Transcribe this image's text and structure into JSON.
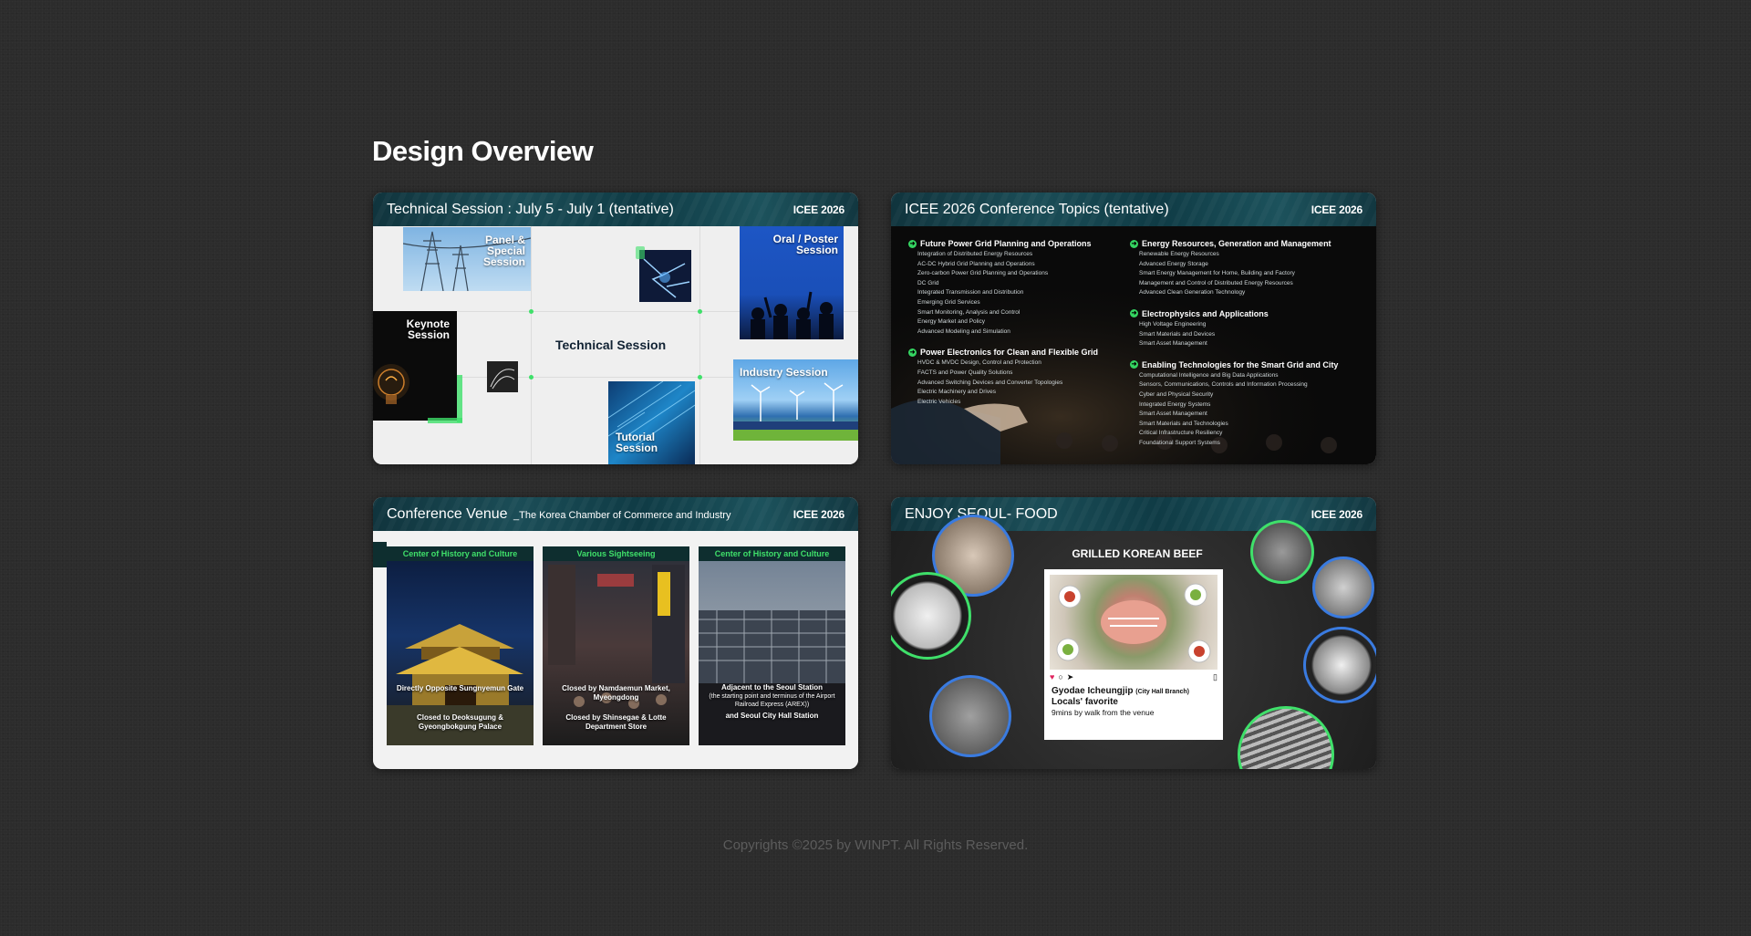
{
  "page_title": "Design Overview",
  "cards": [
    {
      "title": "Technical Session : July 5 - July 1 (tentative)",
      "badge": "ICEE 2026",
      "tiles": {
        "panel": "Panel & Special Session",
        "oral": "Oral / Poster Session",
        "keynote": "Keynote Session",
        "center": "Technical Session",
        "industry": "Industry Session",
        "tutorial": "Tutorial Session"
      }
    },
    {
      "title": "ICEE 2026 Conference Topics (tentative)",
      "badge": "ICEE 2026",
      "topics_left": [
        {
          "head": "Future Power Grid Planning and Operations",
          "items": [
            "Integration of Distributed Energy Resources",
            "AC-DC Hybrid Grid Planning and Operations",
            "Zero-carbon Power Grid Planning and Operations",
            "DC Grid",
            "Integrated Transmission and Distribution",
            "Emerging Grid Services",
            "Smart Monitoring, Analysis and Control",
            "Energy Market and Policy",
            "Advanced Modeling and Simulation"
          ]
        },
        {
          "head": "Power Electronics for Clean and Flexible Grid",
          "items": [
            "HVDC & MVDC Design, Control and Protection",
            "FACTS and Power Quality Solutions",
            "Advanced Switching Devices and Converter Topologies",
            "Electric Machinery and Drives",
            "Electric Vehicles"
          ]
        }
      ],
      "topics_right": [
        {
          "head": "Energy Resources, Generation and Management",
          "items": [
            "Renewable Energy Resources",
            "Advanced Energy Storage",
            "Smart Energy Management for Home, Building and Factory",
            "Management and Control of Distributed Energy Resources",
            "Advanced Clean Generation Technology"
          ]
        },
        {
          "head": "Electrophysics and Applications",
          "items": [
            "High Voltage Engineering",
            "Smart Materials and Devices",
            "Smart Asset Management"
          ]
        },
        {
          "head": "Enabling Technologies for the Smart Grid and City",
          "items": [
            "Computational Intelligence and Big Data Applications",
            "Sensors, Communications, Controls and Information Processing",
            "Cyber and Physical Security",
            "Integrated Energy Systems",
            "Smart Asset Management",
            "Smart Materials and Technologies",
            "Critical Infrastructure Resiliency",
            "Foundational Support Systems"
          ]
        }
      ]
    },
    {
      "title": "Conference Venue",
      "subtitle": "_The Korea Chamber of Commerce and Industry",
      "badge": "ICEE 2026",
      "venues": [
        {
          "tag": "Center of History and Culture",
          "cap1": "Directly Opposite Sungnyemun Gate",
          "cap2": "Closed to Deoksugung & Gyeongbokgung Palace"
        },
        {
          "tag": "Various Sightseeing",
          "cap1": "Closed by Namdaemun Market, Myeongdong",
          "cap2": "Closed by Shinsegae & Lotte Department Store"
        },
        {
          "tag": "Center of History and Culture",
          "cap1": "Adjacent to the Seoul Station",
          "cap1b": "(the starting point and terminus of the Airport Railroad Express (AREX))",
          "cap2": "and Seoul City Hall Station"
        }
      ]
    },
    {
      "title": "ENJOY SEOUL- FOOD",
      "badge": "ICEE 2026",
      "food_title": "GRILLED KOREAN BEEF",
      "post_name": "Gyodae Icheungjip",
      "post_branch": "(City Hall Branch)",
      "post_fav": "Locals' favorite",
      "post_walk": "9mins by walk from the venue"
    }
  ],
  "footer": "Copyrights ©2025 by WINPT. All Rights Reserved.",
  "colors": {
    "accent_green": "#3fe06a",
    "header_teal": "#1b4d57",
    "background": "#2c2c2c"
  }
}
